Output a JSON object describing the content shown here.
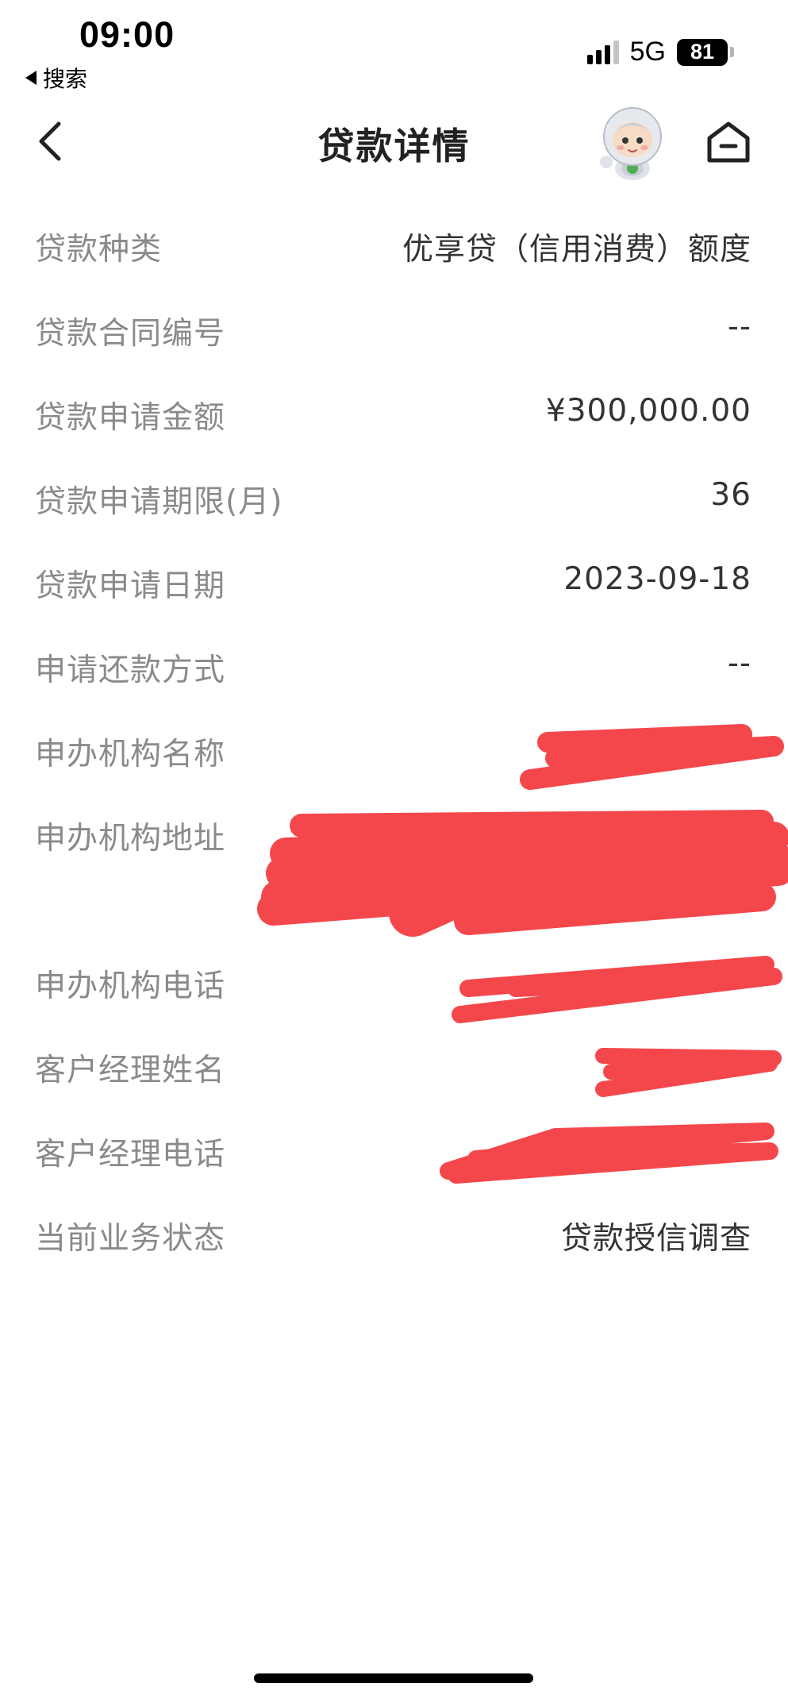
{
  "status_bar": {
    "time": "09:00",
    "back_app": "搜索",
    "network": "5G",
    "battery": "81",
    "signal_bars_active": 3,
    "signal_bars_total": 4
  },
  "nav": {
    "title": "贷款详情",
    "back_icon": "chevron-left-icon",
    "assistant_icon": "robot-mascot-icon",
    "home_icon": "home-icon"
  },
  "details": [
    {
      "label": "贷款种类",
      "value": "优享贷（信用消费）额度"
    },
    {
      "label": "贷款合同编号",
      "value": "--"
    },
    {
      "label": "贷款申请金额",
      "value": "¥300,000.00"
    },
    {
      "label": "贷款申请期限(月)",
      "value": "36"
    },
    {
      "label": "贷款申请日期",
      "value": "2023-09-18"
    },
    {
      "label": "申请还款方式",
      "value": "--"
    },
    {
      "label": "申办机构名称",
      "value": ""
    },
    {
      "label": "申办机构地址",
      "value": ""
    },
    {
      "label": "申办机构电话",
      "value": ""
    },
    {
      "label": "客户经理姓名",
      "value": ""
    },
    {
      "label": "客户经理电话",
      "value": ""
    },
    {
      "label": "当前业务状态",
      "value": "贷款授信调查"
    }
  ],
  "colors": {
    "redaction": "#f4474c",
    "label": "#8a8a8a",
    "value": "#333333"
  }
}
